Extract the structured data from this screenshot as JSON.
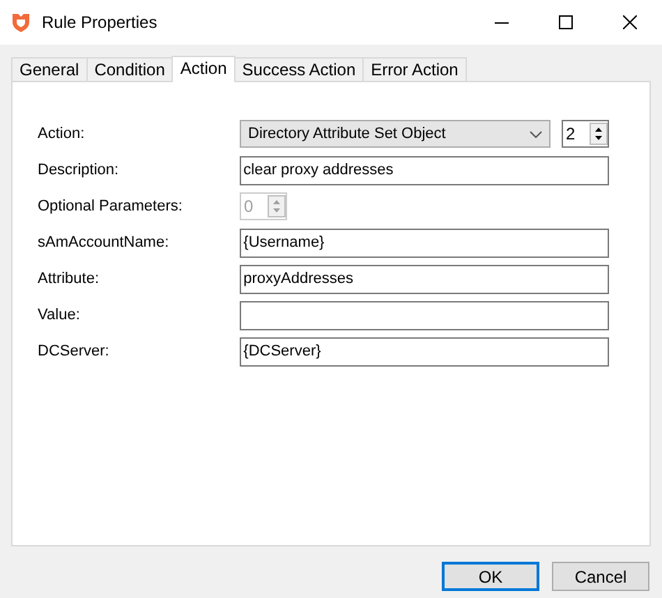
{
  "window": {
    "title": "Rule Properties"
  },
  "tabs": [
    {
      "label": "General",
      "selected": false
    },
    {
      "label": "Condition",
      "selected": false
    },
    {
      "label": "Action",
      "selected": true
    },
    {
      "label": "Success Action",
      "selected": false
    },
    {
      "label": "Error Action",
      "selected": false
    }
  ],
  "fields": [
    {
      "label": "Action:",
      "kind": "combo",
      "value": "Directory Attribute Set Object",
      "spin_value": "2"
    },
    {
      "label": "Description:",
      "kind": "text",
      "value": "clear proxy addresses"
    },
    {
      "label": "Optional Parameters:",
      "kind": "spin",
      "value": "0",
      "disabled": true
    },
    {
      "label": "sAmAccountName:",
      "kind": "text",
      "value": "{Username}"
    },
    {
      "label": "Attribute:",
      "kind": "text",
      "value": "proxyAddresses"
    },
    {
      "label": "Value:",
      "kind": "text"
    },
    {
      "label": "DCServer:",
      "kind": "text",
      "value": "{DCServer}"
    }
  ],
  "buttons": [
    {
      "label": "OK",
      "default": true
    },
    {
      "label": "Cancel",
      "default": false
    }
  ]
}
